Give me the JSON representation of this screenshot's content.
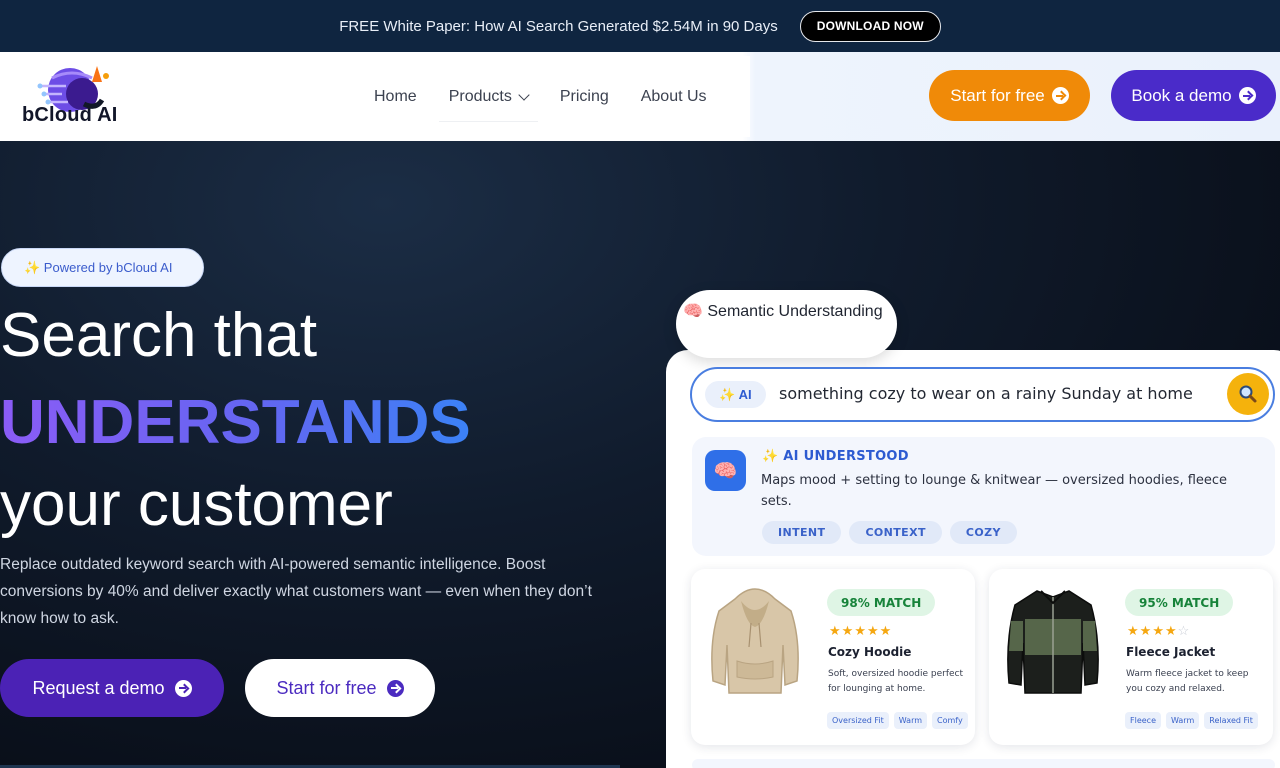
{
  "banner": {
    "text": "FREE White Paper: How AI Search Generated $2.54M in 90 Days",
    "cta": "DOWNLOAD NOW"
  },
  "nav": {
    "logo_text": "bCloud AI",
    "links": [
      "Home",
      "Products",
      "Pricing",
      "About Us"
    ],
    "start_free": "Start for free",
    "book_demo": "Book a demo"
  },
  "hero": {
    "badge": "✨ Powered by bCloud AI",
    "title_line1": "Search that",
    "title_line2": "UNDERSTANDS",
    "title_line3": "your customer",
    "subtitle": "Replace outdated keyword search with AI-powered semantic intelligence. Boost conversions by 40% and deliver exactly what customers want — even when they don’t know how to ask.",
    "request_demo": "Request a demo",
    "start_free": "Start for free"
  },
  "demo": {
    "bubble_icon": "🧠",
    "bubble_text": "Semantic Understanding",
    "ai_chip": "✨ AI",
    "query": "something cozy to wear on a rainy Sunday at home",
    "understood_title": "✨ AI UNDERSTOOD",
    "understood_desc": "Maps mood + setting to lounge & knitwear — oversized hoodies, fleece sets.",
    "tags": [
      "INTENT",
      "CONTEXT",
      "COZY"
    ],
    "products": [
      {
        "match": "98% MATCH",
        "rating": 5,
        "name": "Cozy Hoodie",
        "desc": "Soft, oversized hoodie perfect for lounging at home.",
        "tags": [
          "Oversized Fit",
          "Warm",
          "Comfy"
        ]
      },
      {
        "match": "95% MATCH",
        "rating": 4,
        "name": "Fleece Jacket",
        "desc": "Warm fleece jacket to keep you cozy and relaxed.",
        "tags": [
          "Fleece",
          "Warm",
          "Relaxed Fit"
        ]
      }
    ]
  },
  "colors": {
    "banner_bg": "#0f2540",
    "orange": "#f08a08",
    "purple": "#4a2bc9",
    "search_yellow": "#f5b20c",
    "match_green": "#17833a"
  }
}
